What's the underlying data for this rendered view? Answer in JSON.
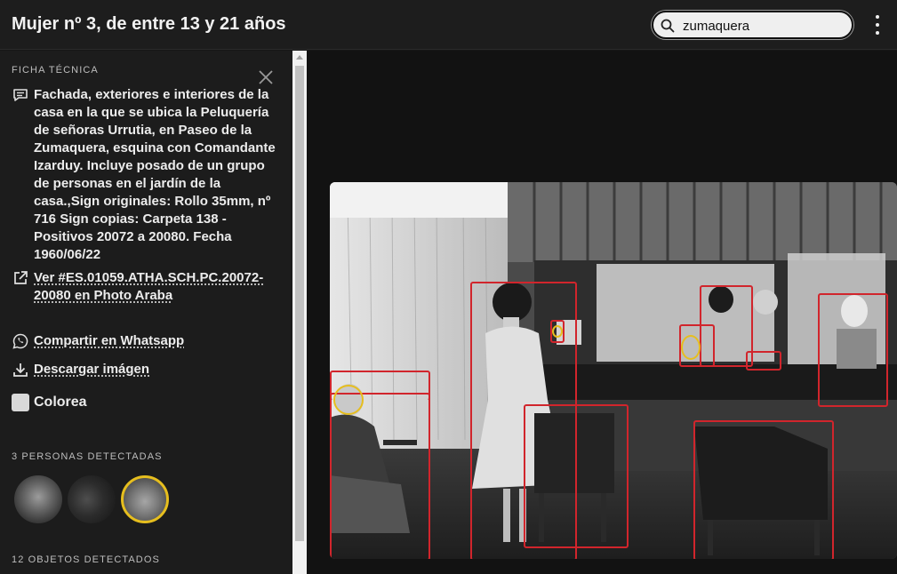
{
  "header": {
    "title": "Mujer nº 3, de entre 13 y 21 años",
    "search_value": "zumaquera",
    "search_icon": "search-icon",
    "menu_icon": "more-vertical-icon"
  },
  "sidebar": {
    "tech_label": "FICHA TÉCNICA",
    "close_icon": "close-icon",
    "description": "Fachada, exteriores e interiores de la casa en la que se ubica la Peluquería de señoras Urrutia, en Paseo de la Zumaquera, esquina con Comandante Izarduy. Incluye posado de un grupo de personas en el jardín de la casa.,Sign originales: Rollo 35mm, nº 716 Sign copias: Carpeta 138 - Positivos 20072 a 20080. Fecha 1960/06/22",
    "view_link": "Ver #ES.01059.ATHA.SCH.PC.20072-20080 en Photo Araba",
    "whatsapp_link": "Compartir en Whatsapp",
    "download_link": "Descargar imágen",
    "colorize_label": "Colorea",
    "persons_label": "3 PERSONAS DETECTADAS",
    "objects_label": "12 OBJETOS DETECTADOS",
    "selected_face_color": "#e6be1e"
  },
  "detections": {
    "box_color": "#d1252c",
    "face_color": "#e6be1e"
  }
}
